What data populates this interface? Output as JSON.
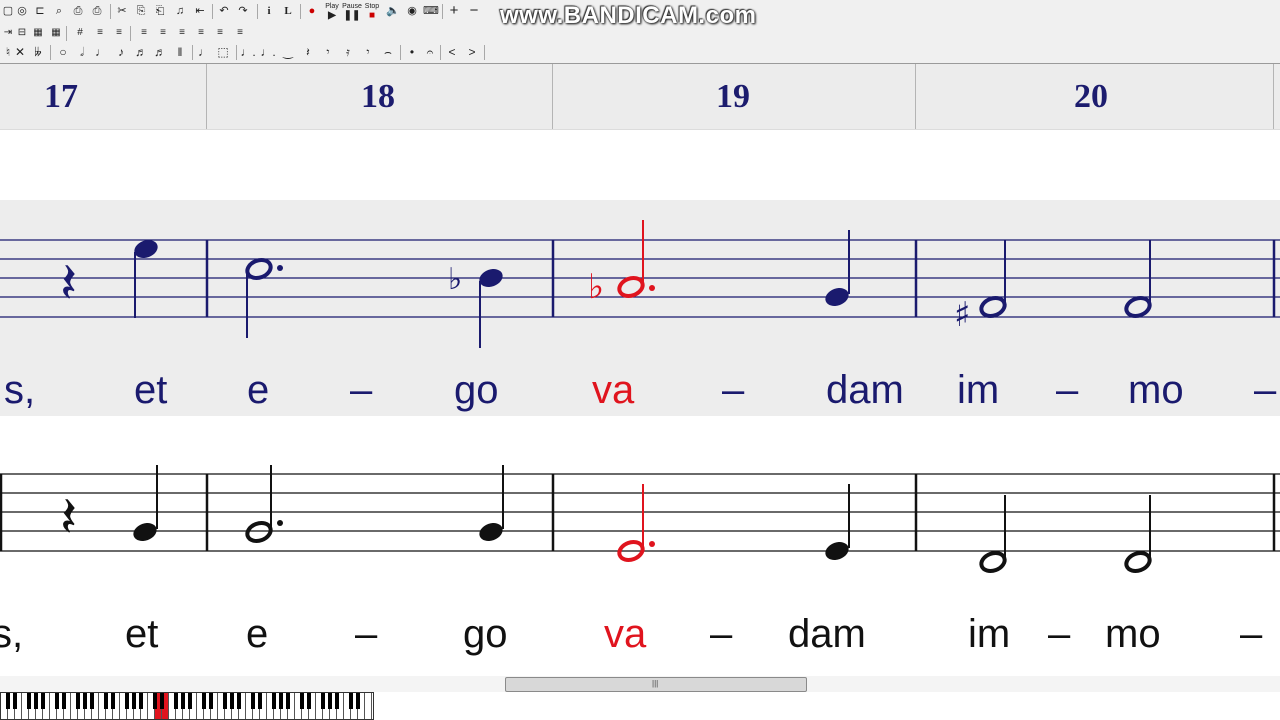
{
  "watermark": "www.BANDICAM.com",
  "toolbar": {
    "playback": {
      "play": "Play",
      "pause": "Pause",
      "stop": "Stop"
    },
    "zoom_in": "+",
    "zoom_out": "−",
    "sym": {
      "new": "▢",
      "open": "✎",
      "glasses": "◎",
      "vline": "⊏",
      "search": "⌕",
      "preview": "⎙",
      "print": "⎙",
      "cut": "✂",
      "copy": "⎘",
      "paste": "⎗",
      "music": "♫",
      "rewind": "⇤",
      "undo": "↶",
      "redo": "↷",
      "text_tool": "i",
      "line_tool": "L",
      "record": "●",
      "speaker": "🔈",
      "disc": "◉",
      "keyboard": "⌨",
      "rest_bar": "⇥",
      "ledger": "⊟",
      "sharp_grid": "#",
      "double_flat": "𝄫",
      "whole": "○",
      "half": "𝅗𝅥",
      "quarter": "♩",
      "eighth": "♪",
      "sixteenth": "♬",
      "sixteenth2": "♬",
      "double_bar": "‖",
      "align_left": "≡",
      "align_center": "≡",
      "align_right": "≡",
      "justify": "≡",
      "grid1": "▦",
      "grid2": "▦",
      "natural_sign": "♮",
      "cross": "✕",
      "fermata": "𝄐",
      "dot_q": "♩.",
      "tie": "‿",
      "rest_q": "𝄽",
      "rest_e": "𝄾",
      "rest_s": "𝄿",
      "tuplet": "⌢",
      "accent_gt": "<",
      "accent_lt": ">",
      "staccato": "•",
      "dashed_box": "⬚",
      "crescendo": "<",
      "diminuendo": ">"
    }
  },
  "measure_numbers": [
    "17",
    "18",
    "19",
    "20"
  ],
  "accidentals": {
    "flat": "♭",
    "sharp": "♯"
  },
  "rest_glyph": "𝄽",
  "colors": {
    "upper_staff": "#1a1a6e",
    "lower_staff": "#111111",
    "highlight": "#e0141e",
    "band": "#ededed"
  },
  "upper_lyrics": [
    {
      "text": "s,",
      "highlight": false
    },
    {
      "text": "et",
      "highlight": false
    },
    {
      "text": "e",
      "highlight": false
    },
    {
      "text": "–",
      "highlight": false
    },
    {
      "text": "go",
      "highlight": false
    },
    {
      "text": "va",
      "highlight": true
    },
    {
      "text": "–",
      "highlight": false
    },
    {
      "text": "dam",
      "highlight": false
    },
    {
      "text": "im",
      "highlight": false
    },
    {
      "text": "–",
      "highlight": false
    },
    {
      "text": "mo",
      "highlight": false
    },
    {
      "text": "–",
      "highlight": false
    }
  ],
  "lower_lyrics": [
    {
      "text": "s,",
      "highlight": false
    },
    {
      "text": "et",
      "highlight": false
    },
    {
      "text": "e",
      "highlight": false
    },
    {
      "text": "–",
      "highlight": false
    },
    {
      "text": "go",
      "highlight": false
    },
    {
      "text": "va",
      "highlight": true
    },
    {
      "text": "–",
      "highlight": false
    },
    {
      "text": "dam",
      "highlight": false
    },
    {
      "text": "im",
      "highlight": false
    },
    {
      "text": "–",
      "highlight": false
    },
    {
      "text": "mo",
      "highlight": false
    },
    {
      "text": "–",
      "highlight": false
    }
  ],
  "scrollbar_grip": "|||"
}
